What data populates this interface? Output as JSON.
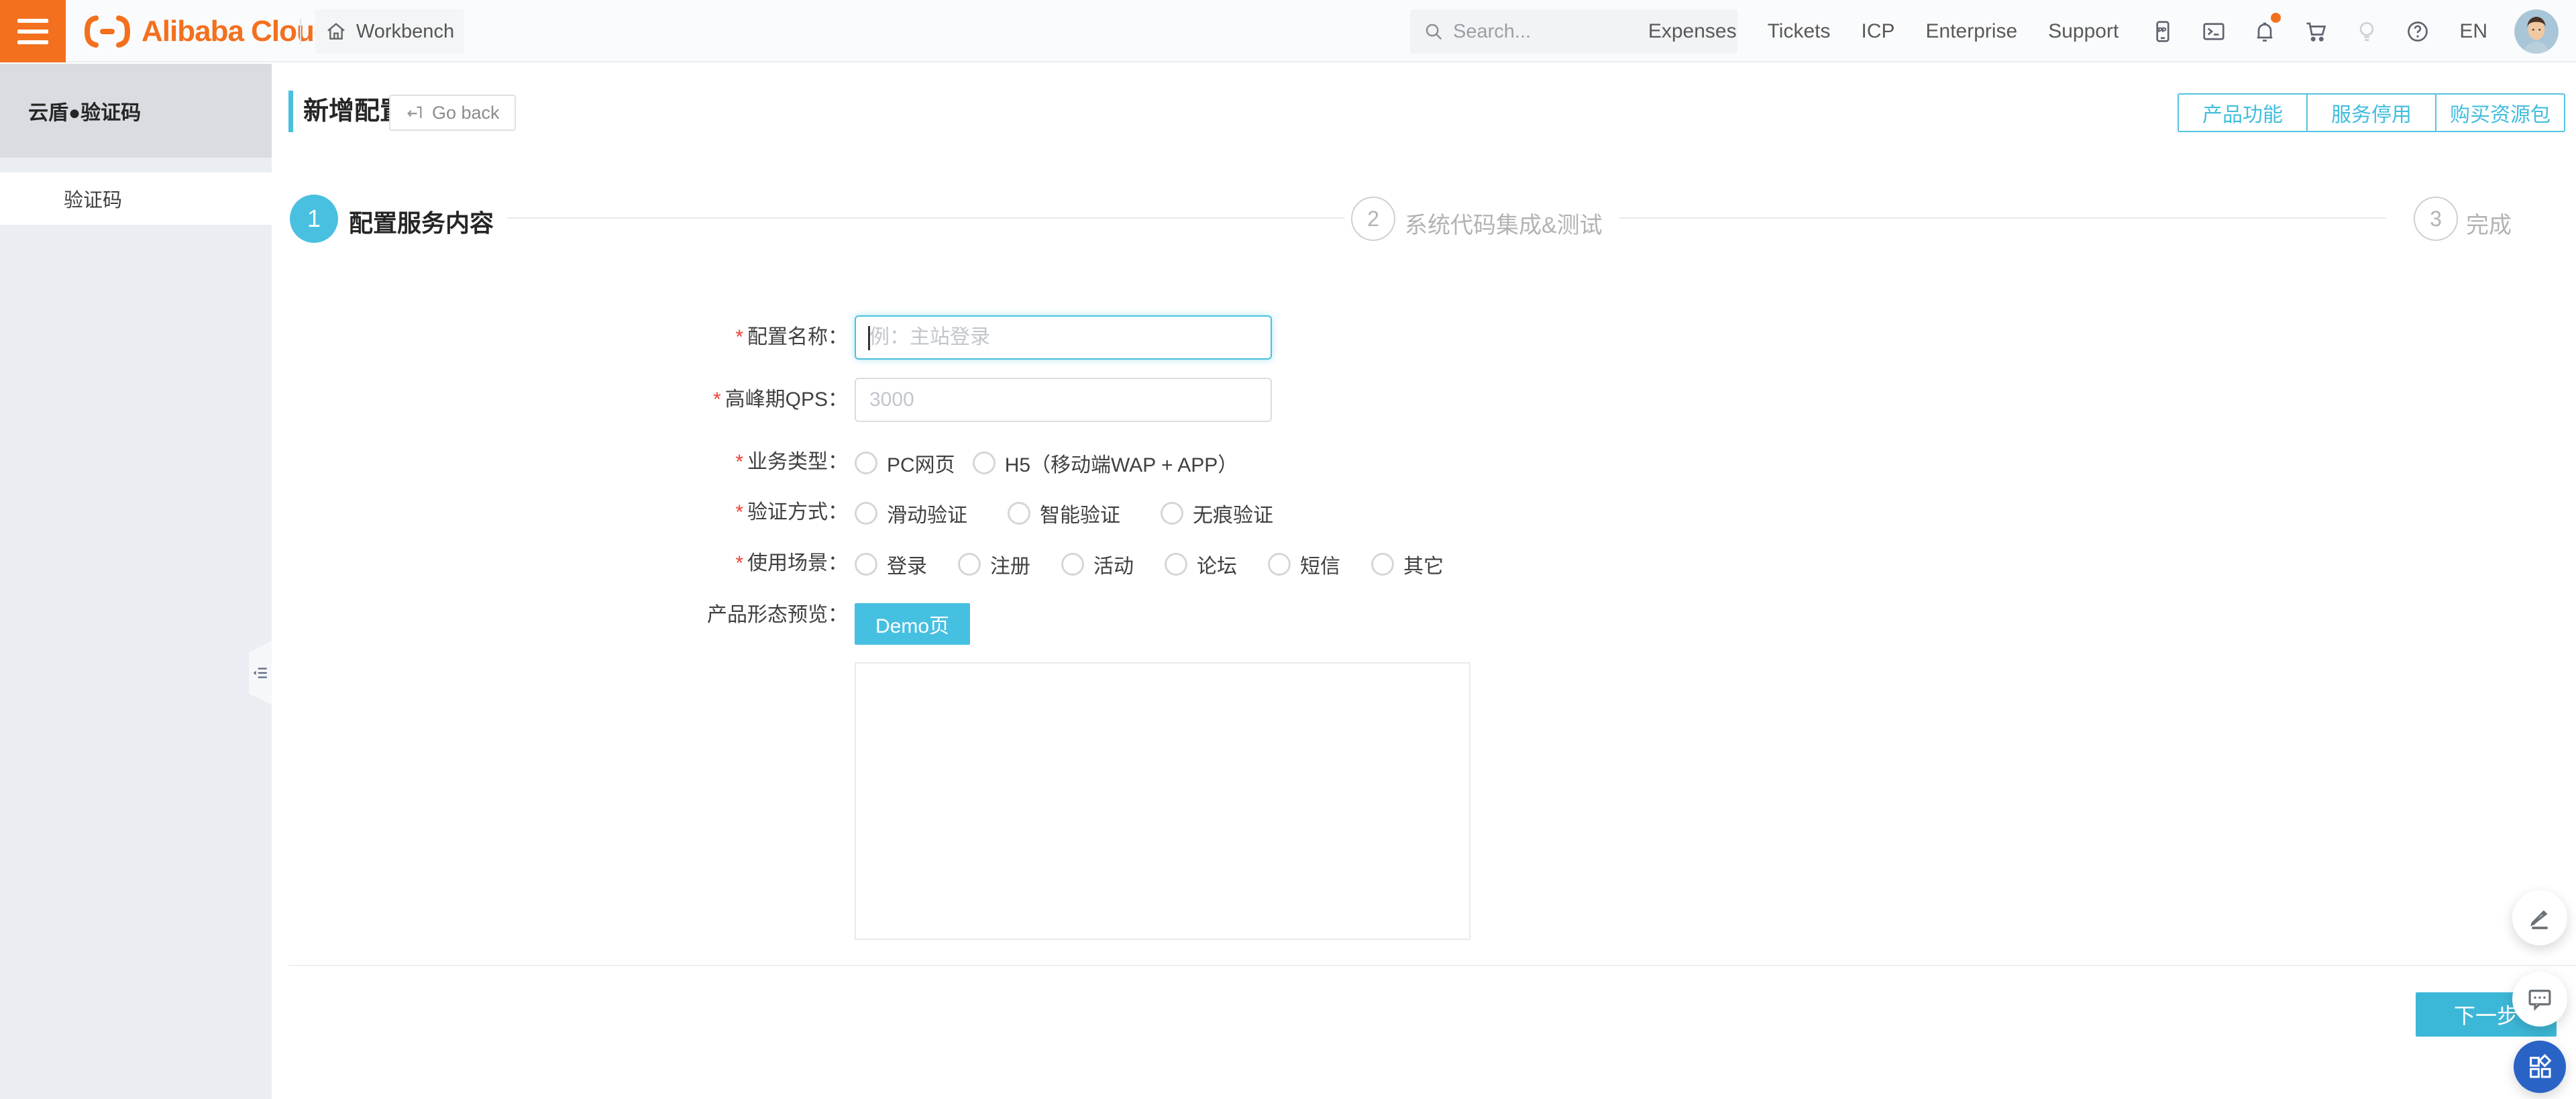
{
  "header": {
    "logo_text": "Alibaba Cloud",
    "workbench": "Workbench",
    "search_placeholder": "Search...",
    "nav": [
      "Expenses",
      "Tickets",
      "ICP",
      "Enterprise",
      "Support"
    ],
    "language": "EN",
    "icon_names": [
      "mobile-app-icon",
      "terminal-icon",
      "bell-icon",
      "cart-icon",
      "lightbulb-icon",
      "help-icon"
    ]
  },
  "sidebar": {
    "title": "云盾●验证码",
    "item": "验证码"
  },
  "page": {
    "title": "新增配置",
    "go_back": "Go back",
    "actions": [
      "产品功能",
      "服务停用",
      "购买资源包"
    ]
  },
  "steps": [
    {
      "num": "1",
      "label": "配置服务内容"
    },
    {
      "num": "2",
      "label": "系统代码集成&测试"
    },
    {
      "num": "3",
      "label": "完成"
    }
  ],
  "form": {
    "required_mark": "*",
    "config_name": {
      "label": "配置名称：",
      "placeholder": "例：主站登录"
    },
    "qps": {
      "label": "高峰期QPS：",
      "placeholder": "3000"
    },
    "biz_type": {
      "label": "业务类型：",
      "options": [
        "PC网页",
        "H5（移动端WAP + APP）"
      ]
    },
    "verify_mode": {
      "label": "验证方式：",
      "options": [
        "滑动验证",
        "智能验证",
        "无痕验证"
      ]
    },
    "scene": {
      "label": "使用场景：",
      "options": [
        "登录",
        "注册",
        "活动",
        "论坛",
        "短信",
        "其它"
      ]
    },
    "preview": {
      "label": "产品形态预览：",
      "demo_button": "Demo页"
    },
    "next_button": "下一步"
  },
  "colors": {
    "accent": "#4ac0e0",
    "brand_orange": "#f3701e",
    "fab_blue": "#2a63c6",
    "required_red": "#f04134"
  }
}
